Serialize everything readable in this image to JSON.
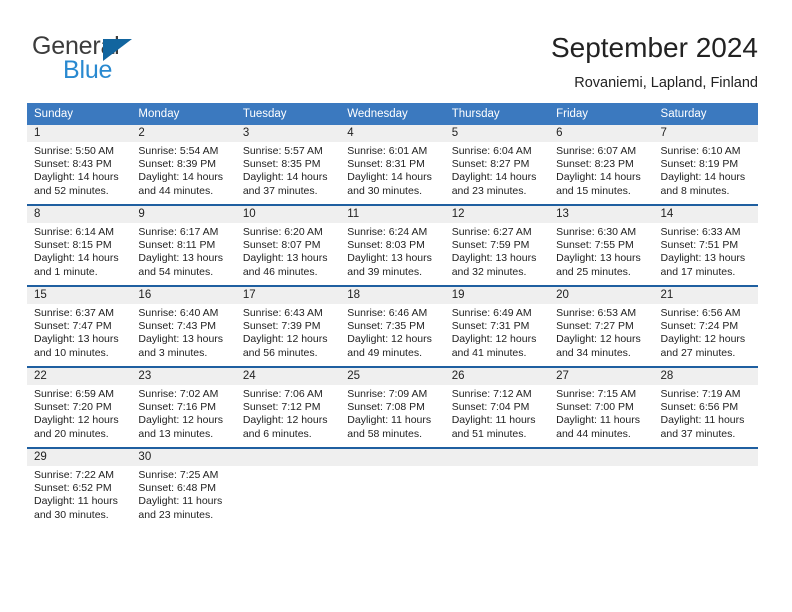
{
  "logo": {
    "word_one": "General",
    "word_two": "Blue",
    "triangle_color": "#12659f",
    "blue_color": "#2989d0",
    "gray_color": "#3c3c3c"
  },
  "header": {
    "month_title": "September 2024",
    "location": "Rovaniemi, Lapland, Finland"
  },
  "theme": {
    "header_blue": "#3b79bf",
    "row_divider_blue": "#1f5fa0",
    "daynum_band": "#efefef"
  },
  "weekday_headers": [
    "Sunday",
    "Monday",
    "Tuesday",
    "Wednesday",
    "Thursday",
    "Friday",
    "Saturday"
  ],
  "weeks": [
    [
      {
        "day": "1",
        "sunrise": "Sunrise: 5:50 AM",
        "sunset": "Sunset: 8:43 PM",
        "daylight_1": "Daylight: 14 hours",
        "daylight_2": "and 52 minutes."
      },
      {
        "day": "2",
        "sunrise": "Sunrise: 5:54 AM",
        "sunset": "Sunset: 8:39 PM",
        "daylight_1": "Daylight: 14 hours",
        "daylight_2": "and 44 minutes."
      },
      {
        "day": "3",
        "sunrise": "Sunrise: 5:57 AM",
        "sunset": "Sunset: 8:35 PM",
        "daylight_1": "Daylight: 14 hours",
        "daylight_2": "and 37 minutes."
      },
      {
        "day": "4",
        "sunrise": "Sunrise: 6:01 AM",
        "sunset": "Sunset: 8:31 PM",
        "daylight_1": "Daylight: 14 hours",
        "daylight_2": "and 30 minutes."
      },
      {
        "day": "5",
        "sunrise": "Sunrise: 6:04 AM",
        "sunset": "Sunset: 8:27 PM",
        "daylight_1": "Daylight: 14 hours",
        "daylight_2": "and 23 minutes."
      },
      {
        "day": "6",
        "sunrise": "Sunrise: 6:07 AM",
        "sunset": "Sunset: 8:23 PM",
        "daylight_1": "Daylight: 14 hours",
        "daylight_2": "and 15 minutes."
      },
      {
        "day": "7",
        "sunrise": "Sunrise: 6:10 AM",
        "sunset": "Sunset: 8:19 PM",
        "daylight_1": "Daylight: 14 hours",
        "daylight_2": "and 8 minutes."
      }
    ],
    [
      {
        "day": "8",
        "sunrise": "Sunrise: 6:14 AM",
        "sunset": "Sunset: 8:15 PM",
        "daylight_1": "Daylight: 14 hours",
        "daylight_2": "and 1 minute."
      },
      {
        "day": "9",
        "sunrise": "Sunrise: 6:17 AM",
        "sunset": "Sunset: 8:11 PM",
        "daylight_1": "Daylight: 13 hours",
        "daylight_2": "and 54 minutes."
      },
      {
        "day": "10",
        "sunrise": "Sunrise: 6:20 AM",
        "sunset": "Sunset: 8:07 PM",
        "daylight_1": "Daylight: 13 hours",
        "daylight_2": "and 46 minutes."
      },
      {
        "day": "11",
        "sunrise": "Sunrise: 6:24 AM",
        "sunset": "Sunset: 8:03 PM",
        "daylight_1": "Daylight: 13 hours",
        "daylight_2": "and 39 minutes."
      },
      {
        "day": "12",
        "sunrise": "Sunrise: 6:27 AM",
        "sunset": "Sunset: 7:59 PM",
        "daylight_1": "Daylight: 13 hours",
        "daylight_2": "and 32 minutes."
      },
      {
        "day": "13",
        "sunrise": "Sunrise: 6:30 AM",
        "sunset": "Sunset: 7:55 PM",
        "daylight_1": "Daylight: 13 hours",
        "daylight_2": "and 25 minutes."
      },
      {
        "day": "14",
        "sunrise": "Sunrise: 6:33 AM",
        "sunset": "Sunset: 7:51 PM",
        "daylight_1": "Daylight: 13 hours",
        "daylight_2": "and 17 minutes."
      }
    ],
    [
      {
        "day": "15",
        "sunrise": "Sunrise: 6:37 AM",
        "sunset": "Sunset: 7:47 PM",
        "daylight_1": "Daylight: 13 hours",
        "daylight_2": "and 10 minutes."
      },
      {
        "day": "16",
        "sunrise": "Sunrise: 6:40 AM",
        "sunset": "Sunset: 7:43 PM",
        "daylight_1": "Daylight: 13 hours",
        "daylight_2": "and 3 minutes."
      },
      {
        "day": "17",
        "sunrise": "Sunrise: 6:43 AM",
        "sunset": "Sunset: 7:39 PM",
        "daylight_1": "Daylight: 12 hours",
        "daylight_2": "and 56 minutes."
      },
      {
        "day": "18",
        "sunrise": "Sunrise: 6:46 AM",
        "sunset": "Sunset: 7:35 PM",
        "daylight_1": "Daylight: 12 hours",
        "daylight_2": "and 49 minutes."
      },
      {
        "day": "19",
        "sunrise": "Sunrise: 6:49 AM",
        "sunset": "Sunset: 7:31 PM",
        "daylight_1": "Daylight: 12 hours",
        "daylight_2": "and 41 minutes."
      },
      {
        "day": "20",
        "sunrise": "Sunrise: 6:53 AM",
        "sunset": "Sunset: 7:27 PM",
        "daylight_1": "Daylight: 12 hours",
        "daylight_2": "and 34 minutes."
      },
      {
        "day": "21",
        "sunrise": "Sunrise: 6:56 AM",
        "sunset": "Sunset: 7:24 PM",
        "daylight_1": "Daylight: 12 hours",
        "daylight_2": "and 27 minutes."
      }
    ],
    [
      {
        "day": "22",
        "sunrise": "Sunrise: 6:59 AM",
        "sunset": "Sunset: 7:20 PM",
        "daylight_1": "Daylight: 12 hours",
        "daylight_2": "and 20 minutes."
      },
      {
        "day": "23",
        "sunrise": "Sunrise: 7:02 AM",
        "sunset": "Sunset: 7:16 PM",
        "daylight_1": "Daylight: 12 hours",
        "daylight_2": "and 13 minutes."
      },
      {
        "day": "24",
        "sunrise": "Sunrise: 7:06 AM",
        "sunset": "Sunset: 7:12 PM",
        "daylight_1": "Daylight: 12 hours",
        "daylight_2": "and 6 minutes."
      },
      {
        "day": "25",
        "sunrise": "Sunrise: 7:09 AM",
        "sunset": "Sunset: 7:08 PM",
        "daylight_1": "Daylight: 11 hours",
        "daylight_2": "and 58 minutes."
      },
      {
        "day": "26",
        "sunrise": "Sunrise: 7:12 AM",
        "sunset": "Sunset: 7:04 PM",
        "daylight_1": "Daylight: 11 hours",
        "daylight_2": "and 51 minutes."
      },
      {
        "day": "27",
        "sunrise": "Sunrise: 7:15 AM",
        "sunset": "Sunset: 7:00 PM",
        "daylight_1": "Daylight: 11 hours",
        "daylight_2": "and 44 minutes."
      },
      {
        "day": "28",
        "sunrise": "Sunrise: 7:19 AM",
        "sunset": "Sunset: 6:56 PM",
        "daylight_1": "Daylight: 11 hours",
        "daylight_2": "and 37 minutes."
      }
    ],
    [
      {
        "day": "29",
        "sunrise": "Sunrise: 7:22 AM",
        "sunset": "Sunset: 6:52 PM",
        "daylight_1": "Daylight: 11 hours",
        "daylight_2": "and 30 minutes."
      },
      {
        "day": "30",
        "sunrise": "Sunrise: 7:25 AM",
        "sunset": "Sunset: 6:48 PM",
        "daylight_1": "Daylight: 11 hours",
        "daylight_2": "and 23 minutes."
      },
      {
        "day": "",
        "sunrise": "",
        "sunset": "",
        "daylight_1": "",
        "daylight_2": ""
      },
      {
        "day": "",
        "sunrise": "",
        "sunset": "",
        "daylight_1": "",
        "daylight_2": ""
      },
      {
        "day": "",
        "sunrise": "",
        "sunset": "",
        "daylight_1": "",
        "daylight_2": ""
      },
      {
        "day": "",
        "sunrise": "",
        "sunset": "",
        "daylight_1": "",
        "daylight_2": ""
      },
      {
        "day": "",
        "sunrise": "",
        "sunset": "",
        "daylight_1": "",
        "daylight_2": ""
      }
    ]
  ]
}
